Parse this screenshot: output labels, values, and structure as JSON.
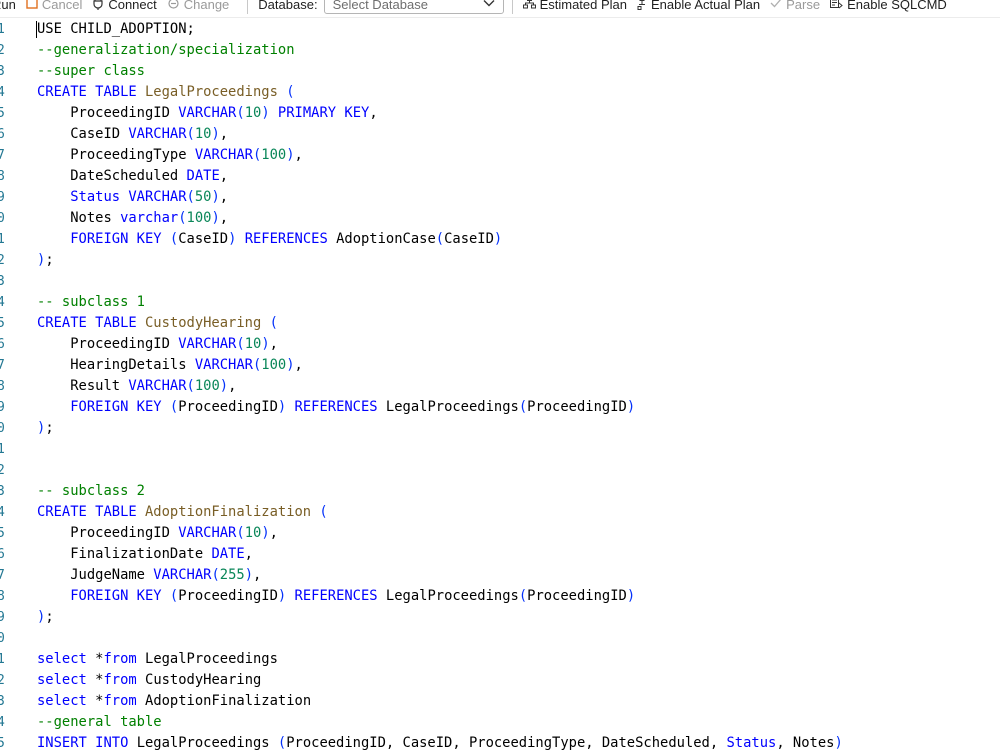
{
  "toolbar": {
    "run_label": "Run",
    "cancel_label": "Cancel",
    "connect_label": "Connect",
    "change_label": "Change",
    "database_label": "Database:",
    "database_placeholder": "Select Database",
    "estimated_plan_label": "Estimated Plan",
    "actual_plan_label": "Enable Actual Plan",
    "parse_label": "Parse",
    "sqlcmd_label": "Enable SQLCMD"
  },
  "editor": {
    "line_numbers": [
      "1",
      "2",
      "3",
      "4",
      "5",
      "6",
      "7",
      "8",
      "9",
      "0",
      "1",
      "2",
      "3",
      "4",
      "5",
      "6",
      "7",
      "8",
      "9",
      "0",
      "1",
      "2",
      "3",
      "4",
      "5",
      "6",
      "7",
      "8",
      "9",
      "0",
      "1",
      "2",
      "3",
      "4",
      "5"
    ],
    "lines": [
      [
        [
          "plain",
          "USE CHILD_ADOPTION;"
        ]
      ],
      [
        [
          "cmt",
          "--generalization/specialization"
        ]
      ],
      [
        [
          "cmt",
          "--super class"
        ]
      ],
      [
        [
          "kw",
          "CREATE TABLE "
        ],
        [
          "ident",
          "LegalProceedings "
        ],
        [
          "paren",
          "("
        ]
      ],
      [
        [
          "plain",
          "    ProceedingID "
        ],
        [
          "kw",
          "VARCHAR"
        ],
        [
          "paren",
          "("
        ],
        [
          "num",
          "10"
        ],
        [
          "paren",
          ")"
        ],
        [
          "kw",
          " PRIMARY KEY"
        ],
        [
          "plain",
          ","
        ]
      ],
      [
        [
          "plain",
          "    CaseID "
        ],
        [
          "kw",
          "VARCHAR"
        ],
        [
          "paren",
          "("
        ],
        [
          "num",
          "10"
        ],
        [
          "paren",
          ")"
        ],
        [
          "plain",
          ","
        ]
      ],
      [
        [
          "plain",
          "    ProceedingType "
        ],
        [
          "kw",
          "VARCHAR"
        ],
        [
          "paren",
          "("
        ],
        [
          "num",
          "100"
        ],
        [
          "paren",
          ")"
        ],
        [
          "plain",
          ","
        ]
      ],
      [
        [
          "plain",
          "    DateScheduled "
        ],
        [
          "kw",
          "DATE"
        ],
        [
          "plain",
          ","
        ]
      ],
      [
        [
          "plain",
          "    "
        ],
        [
          "kw",
          "Status VARCHAR"
        ],
        [
          "paren",
          "("
        ],
        [
          "num",
          "50"
        ],
        [
          "paren",
          ")"
        ],
        [
          "plain",
          ","
        ]
      ],
      [
        [
          "plain",
          "    Notes "
        ],
        [
          "kw",
          "varchar"
        ],
        [
          "paren",
          "("
        ],
        [
          "num",
          "100"
        ],
        [
          "paren",
          ")"
        ],
        [
          "plain",
          ","
        ]
      ],
      [
        [
          "plain",
          "    "
        ],
        [
          "kw",
          "FOREIGN KEY "
        ],
        [
          "paren",
          "("
        ],
        [
          "plain",
          "CaseID"
        ],
        [
          "paren",
          ")"
        ],
        [
          "kw",
          " REFERENCES "
        ],
        [
          "plain",
          "AdoptionCase"
        ],
        [
          "paren",
          "("
        ],
        [
          "plain",
          "CaseID"
        ],
        [
          "paren",
          ")"
        ]
      ],
      [
        [
          "paren",
          ")"
        ],
        [
          "plain",
          ";"
        ]
      ],
      [
        [
          "plain",
          ""
        ]
      ],
      [
        [
          "cmt",
          "-- subclass 1"
        ]
      ],
      [
        [
          "kw",
          "CREATE TABLE "
        ],
        [
          "ident",
          "CustodyHearing "
        ],
        [
          "paren",
          "("
        ]
      ],
      [
        [
          "plain",
          "    ProceedingID "
        ],
        [
          "kw",
          "VARCHAR"
        ],
        [
          "paren",
          "("
        ],
        [
          "num",
          "10"
        ],
        [
          "paren",
          ")"
        ],
        [
          "plain",
          ","
        ]
      ],
      [
        [
          "plain",
          "    HearingDetails "
        ],
        [
          "kw",
          "VARCHAR"
        ],
        [
          "paren",
          "("
        ],
        [
          "num",
          "100"
        ],
        [
          "paren",
          ")"
        ],
        [
          "plain",
          ","
        ]
      ],
      [
        [
          "plain",
          "    Result "
        ],
        [
          "kw",
          "VARCHAR"
        ],
        [
          "paren",
          "("
        ],
        [
          "num",
          "100"
        ],
        [
          "paren",
          ")"
        ],
        [
          "plain",
          ","
        ]
      ],
      [
        [
          "plain",
          "    "
        ],
        [
          "kw",
          "FOREIGN KEY "
        ],
        [
          "paren",
          "("
        ],
        [
          "plain",
          "ProceedingID"
        ],
        [
          "paren",
          ")"
        ],
        [
          "kw",
          " REFERENCES "
        ],
        [
          "plain",
          "LegalProceedings"
        ],
        [
          "paren",
          "("
        ],
        [
          "plain",
          "ProceedingID"
        ],
        [
          "paren",
          ")"
        ]
      ],
      [
        [
          "paren",
          ")"
        ],
        [
          "plain",
          ";"
        ]
      ],
      [
        [
          "plain",
          ""
        ]
      ],
      [
        [
          "plain",
          ""
        ]
      ],
      [
        [
          "cmt",
          "-- subclass 2"
        ]
      ],
      [
        [
          "kw",
          "CREATE TABLE "
        ],
        [
          "ident",
          "AdoptionFinalization "
        ],
        [
          "paren",
          "("
        ]
      ],
      [
        [
          "plain",
          "    ProceedingID "
        ],
        [
          "kw",
          "VARCHAR"
        ],
        [
          "paren",
          "("
        ],
        [
          "num",
          "10"
        ],
        [
          "paren",
          ")"
        ],
        [
          "plain",
          ","
        ]
      ],
      [
        [
          "plain",
          "    FinalizationDate "
        ],
        [
          "kw",
          "DATE"
        ],
        [
          "plain",
          ","
        ]
      ],
      [
        [
          "plain",
          "    JudgeName "
        ],
        [
          "kw",
          "VARCHAR"
        ],
        [
          "paren",
          "("
        ],
        [
          "num",
          "255"
        ],
        [
          "paren",
          ")"
        ],
        [
          "plain",
          ","
        ]
      ],
      [
        [
          "plain",
          "    "
        ],
        [
          "kw",
          "FOREIGN KEY "
        ],
        [
          "paren",
          "("
        ],
        [
          "plain",
          "ProceedingID"
        ],
        [
          "paren",
          ")"
        ],
        [
          "kw",
          " REFERENCES "
        ],
        [
          "plain",
          "LegalProceedings"
        ],
        [
          "paren",
          "("
        ],
        [
          "plain",
          "ProceedingID"
        ],
        [
          "paren",
          ")"
        ]
      ],
      [
        [
          "paren",
          ")"
        ],
        [
          "plain",
          ";"
        ]
      ],
      [
        [
          "plain",
          ""
        ]
      ],
      [
        [
          "kw",
          "select "
        ],
        [
          "op",
          "*"
        ],
        [
          "kw",
          "from "
        ],
        [
          "plain",
          "LegalProceedings"
        ]
      ],
      [
        [
          "kw",
          "select "
        ],
        [
          "op",
          "*"
        ],
        [
          "kw",
          "from "
        ],
        [
          "plain",
          "CustodyHearing"
        ]
      ],
      [
        [
          "kw",
          "select "
        ],
        [
          "op",
          "*"
        ],
        [
          "kw",
          "from "
        ],
        [
          "plain",
          "AdoptionFinalization"
        ]
      ],
      [
        [
          "cmt",
          "--general table"
        ]
      ],
      [
        [
          "kw",
          "INSERT INTO "
        ],
        [
          "plain",
          "LegalProceedings "
        ],
        [
          "paren",
          "("
        ],
        [
          "plain",
          "ProceedingID, CaseID, ProceedingType, DateScheduled, "
        ],
        [
          "kw",
          "Status"
        ],
        [
          "plain",
          ", Notes"
        ],
        [
          "paren",
          ")"
        ]
      ]
    ]
  }
}
